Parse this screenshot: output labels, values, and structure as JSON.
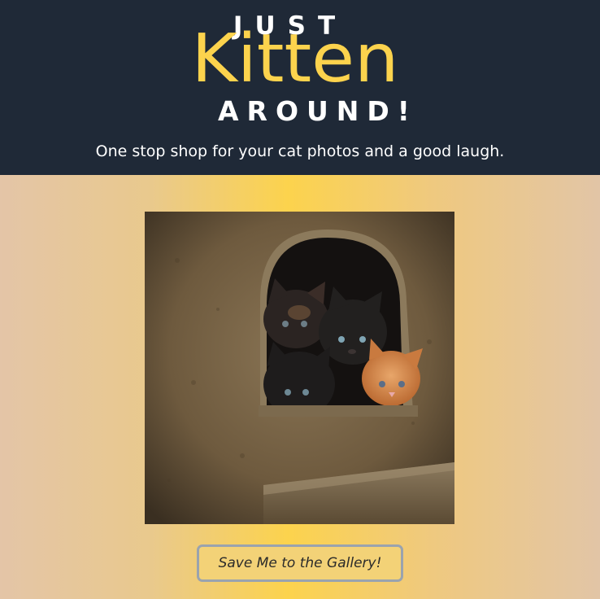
{
  "header": {
    "logo": {
      "line1": "JUST",
      "line2": "Kitten",
      "line3": "AROUND!",
      "accent_color": "#fcd34d"
    },
    "tagline": "One stop shop for your cat photos and a good laugh.",
    "background_color": "#1f2937"
  },
  "main": {
    "photo": {
      "alt": "kittens peeking out of a hole in a wooden cat house"
    },
    "gallery_button_label": "Save Me to the Gallery!"
  },
  "colors": {
    "gradient_center": "#fcd34d",
    "gradient_edge": "#e4c5a7",
    "button_border": "#9aa3ae"
  }
}
